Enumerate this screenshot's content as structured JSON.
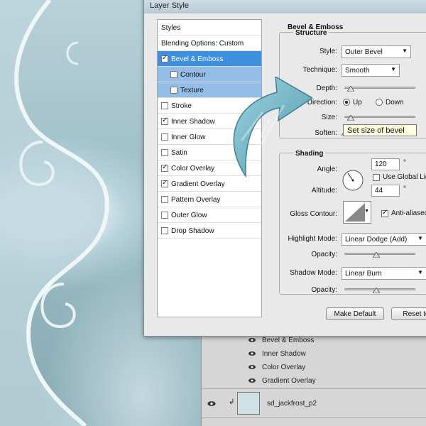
{
  "dialog": {
    "title": "Layer Style",
    "styles_header": "Styles",
    "style_items": [
      {
        "label": "Blending Options: Custom",
        "checked": null
      },
      {
        "label": "Bevel & Emboss",
        "checked": true
      },
      {
        "label": "Contour",
        "checked": false
      },
      {
        "label": "Texture",
        "checked": false
      },
      {
        "label": "Stroke",
        "checked": false
      },
      {
        "label": "Inner Shadow",
        "checked": true
      },
      {
        "label": "Inner Glow",
        "checked": false
      },
      {
        "label": "Satin",
        "checked": false
      },
      {
        "label": "Color Overlay",
        "checked": true
      },
      {
        "label": "Gradient Overlay",
        "checked": true
      },
      {
        "label": "Pattern Overlay",
        "checked": false
      },
      {
        "label": "Outer Glow",
        "checked": false
      },
      {
        "label": "Drop Shadow",
        "checked": false
      }
    ],
    "bevel": {
      "section_title": "Bevel & Emboss",
      "structure_title": "Structure",
      "style_label": "Style:",
      "style_value": "Outer Bevel",
      "technique_label": "Technique:",
      "technique_value": "Smooth",
      "depth_label": "Depth:",
      "direction_label": "Direction:",
      "direction_up": "Up",
      "direction_down": "Down",
      "size_label": "Size:",
      "soften_label": "Soften:",
      "tooltip": "Set size of bevel"
    },
    "shading": {
      "title": "Shading",
      "angle_label": "Angle:",
      "angle_value": "120",
      "degree": "°",
      "global_light_label": "Use Global Lig",
      "altitude_label": "Altitude:",
      "altitude_value": "44",
      "gloss_label": "Gloss Contour:",
      "anti_alias_label": "Anti-aliased",
      "highlight_label": "Highlight Mode:",
      "highlight_value": "Linear Dodge (Add)",
      "opacity_label": "Opacity:",
      "shadow_label": "Shadow Mode:",
      "shadow_value": "Linear Burn",
      "opacity2_label": "Opacity:",
      "opacity_highlight_fraction": 0.45,
      "opacity_shadow_fraction": 0.45
    },
    "buttons": {
      "make_default": "Make Default",
      "reset": "Reset to"
    }
  },
  "layers_panel": {
    "effects": [
      "Bevel & Emboss",
      "Inner Shadow",
      "Color Overlay",
      "Gradient Overlay"
    ],
    "layer_name": "sd_jackfrost_p2"
  },
  "colors": {
    "selected": "#3d8fe0",
    "sub_selected": "#94bde8",
    "arrow": "#6fb4c8"
  }
}
